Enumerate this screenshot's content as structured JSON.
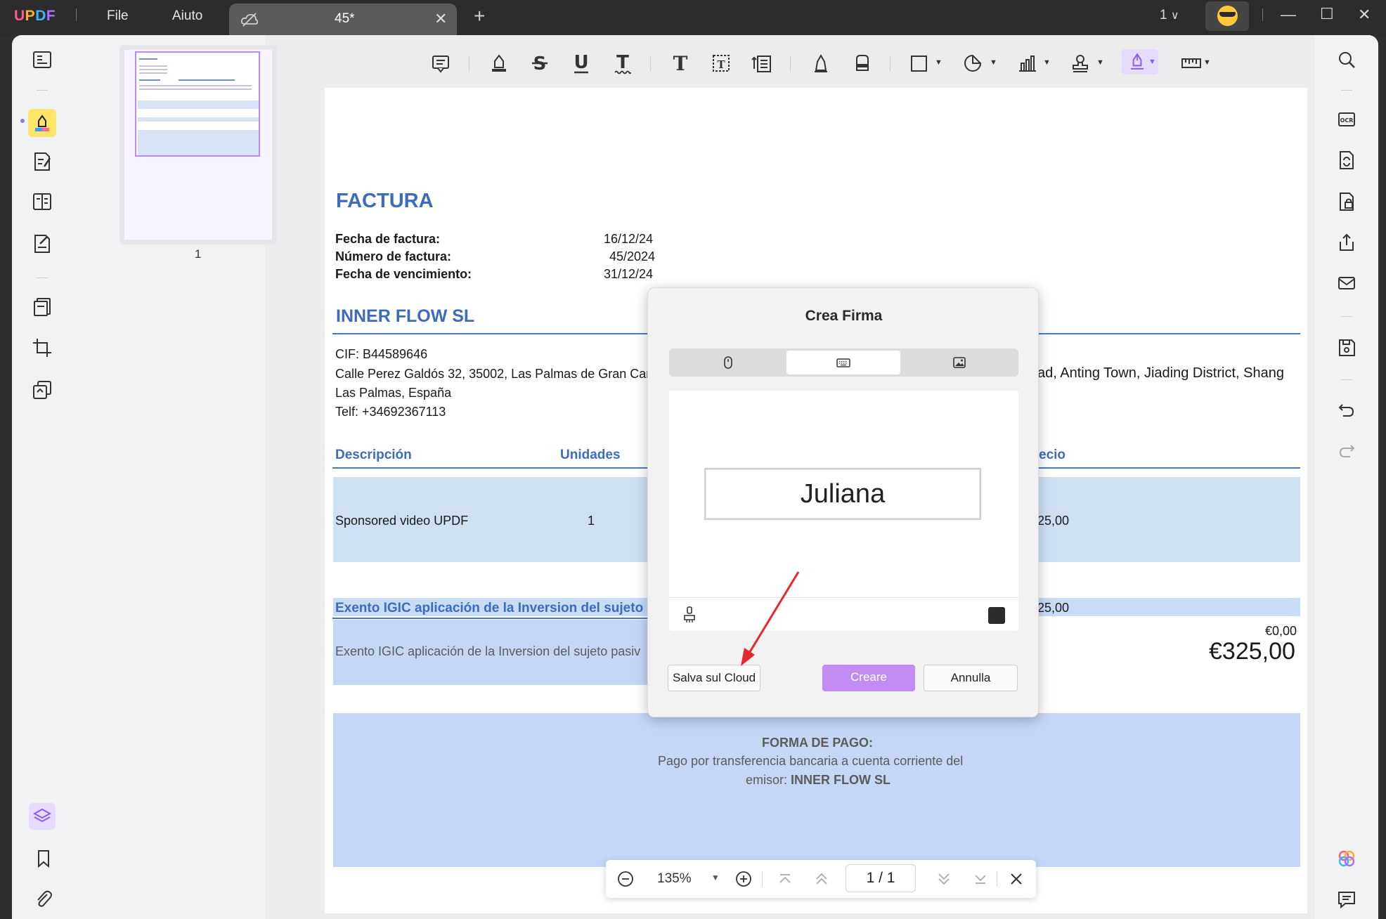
{
  "app": {
    "logo": "UPDF",
    "menu_file": "File",
    "menu_help": "Aiuto",
    "tab_title": "45*",
    "page_count": "1"
  },
  "thumbnail": {
    "page_number": "1"
  },
  "document": {
    "title": "FACTURA",
    "invoice_date_label": "Fecha de factura:",
    "invoice_date": "16/12/24",
    "invoice_number_label": "Número de factura:",
    "invoice_number": "45/2024",
    "due_date_label": "Fecha de vencimiento:",
    "due_date": "31/12/24",
    "company": "INNER FLOW SL",
    "cif": "CIF: B44589646",
    "address": "Calle Perez Galdós 32, 35002, Las Palmas de Gran Can",
    "city": "Las Palmas, España",
    "phone": "Telf: +34692367113",
    "client_address_fragment": "ad, Anting Town, Jiading District, Shang",
    "col_description": "Descripción",
    "col_units": "Unidades",
    "col_price_fragment": "ecio",
    "row_description": "Sponsored video UPDF",
    "row_units": "1",
    "row_price_fragment": "25,00",
    "tax_title": "Exento IGIC aplicación de la Inversion del sujeto",
    "tax_amount_fragment": "25,00",
    "tax_text": "Exento IGIC aplicación de la Inversion del sujeto pasiv",
    "tax_zero": "€0,00",
    "total": "€325,00",
    "payment_title": "FORMA DE PAGO:",
    "payment_line1": "Pago por transferencia bancaria a cuenta corriente del",
    "payment_line2_prefix": "emisor: ",
    "payment_line2_bold": "INNER FLOW SL"
  },
  "dialog": {
    "title": "Crea Firma",
    "signature_text": "Juliana",
    "save_cloud_label": "Salva sul Cloud",
    "create_label": "Creare",
    "cancel_label": "Annulla",
    "ink_color": "#2b2b2b"
  },
  "zoombar": {
    "zoom": "135%",
    "page_indicator": "1 / 1"
  },
  "colors": {
    "accent": "#c38cf5",
    "doc_blue": "#3e6cbc",
    "highlight_yellow": "#ffe66b"
  }
}
